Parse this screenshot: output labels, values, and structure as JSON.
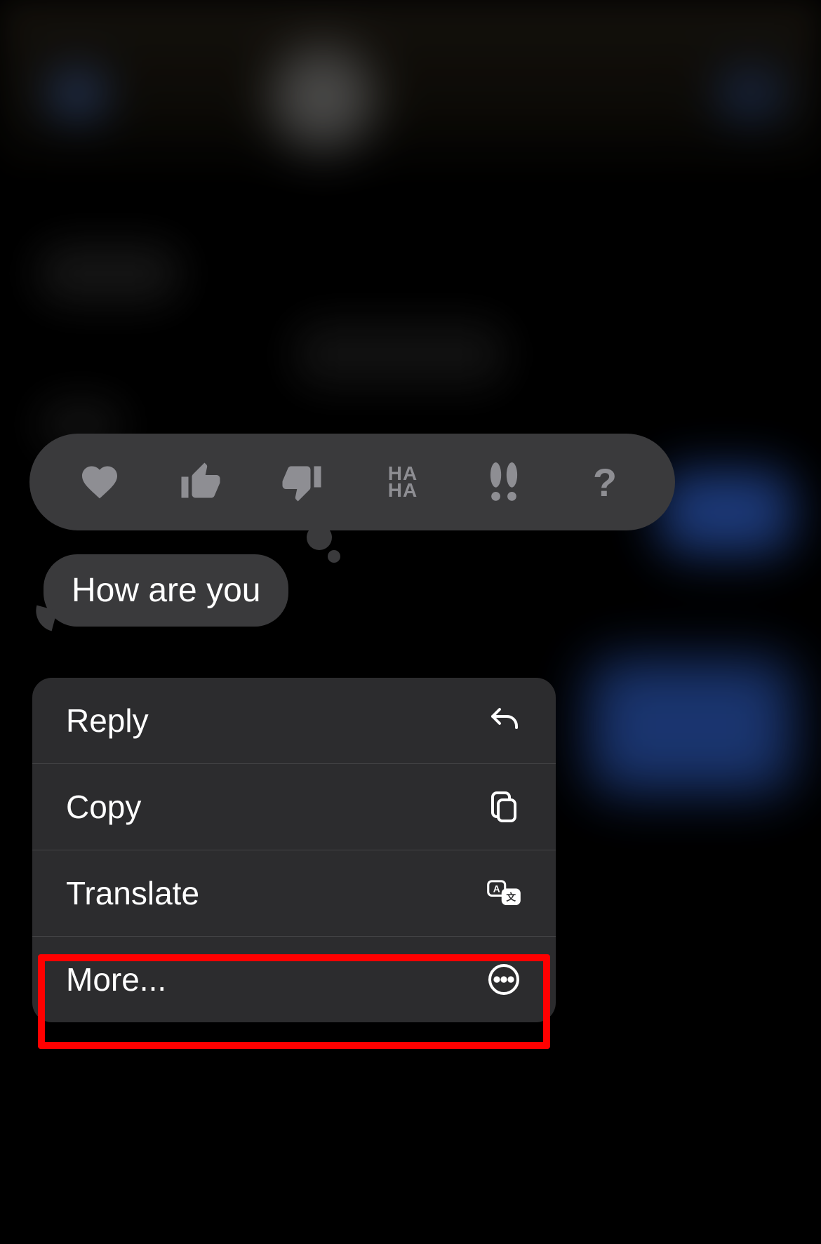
{
  "tapback": {
    "reactions": [
      {
        "name": "heart",
        "label": "Love"
      },
      {
        "name": "thumbs-up",
        "label": "Like"
      },
      {
        "name": "thumbs-down",
        "label": "Dislike"
      },
      {
        "name": "haha",
        "label": "HA HA"
      },
      {
        "name": "exclaim",
        "label": "!!"
      },
      {
        "name": "question",
        "label": "?"
      }
    ]
  },
  "message": {
    "text": "How are you"
  },
  "context_menu": {
    "items": [
      {
        "label": "Reply",
        "icon": "reply-icon"
      },
      {
        "label": "Copy",
        "icon": "copy-icon"
      },
      {
        "label": "Translate",
        "icon": "translate-icon"
      },
      {
        "label": "More...",
        "icon": "more-icon"
      }
    ]
  },
  "annotation": {
    "highlighted_item": "More..."
  }
}
